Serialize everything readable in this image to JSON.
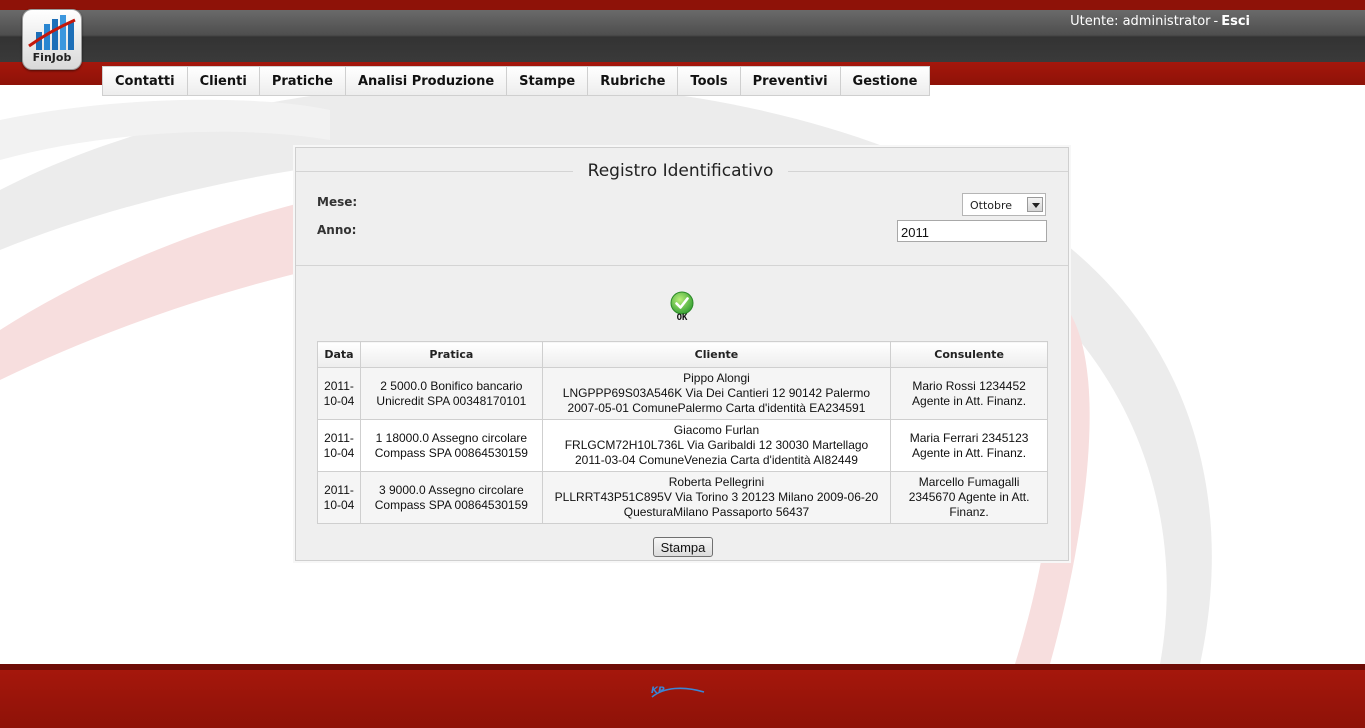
{
  "header": {
    "logo_text": "FinJob",
    "user_label": "Utente: administrator",
    "separator": "-",
    "logout_label": "Esci"
  },
  "nav": {
    "items": [
      "Contatti",
      "Clienti",
      "Pratiche",
      "Analisi Produzione",
      "Stampe",
      "Rubriche",
      "Tools",
      "Preventivi",
      "Gestione"
    ]
  },
  "panel": {
    "title": "Registro Identificativo",
    "month_label": "Mese:",
    "month_value": "Ottobre",
    "year_label": "Anno:",
    "year_value": "2011",
    "ok_label": "OK",
    "print_label": "Stampa"
  },
  "table": {
    "headers": [
      "Data",
      "Pratica",
      "Cliente",
      "Consulente"
    ],
    "rows": [
      {
        "data": [
          "2011-",
          "10-04"
        ],
        "pratica": [
          "2 5000.0 Bonifico bancario",
          "Unicredit SPA 00348170101"
        ],
        "cliente": [
          "Pippo Alongi",
          "LNGPPP69S03A546K Via Dei Cantieri 12 90142 Palermo",
          "2007-05-01 ComunePalermo Carta d'identità EA234591"
        ],
        "consulente": [
          "Mario Rossi 1234452",
          "Agente in Att. Finanz."
        ]
      },
      {
        "data": [
          "2011-",
          "10-04"
        ],
        "pratica": [
          "1 18000.0 Assegno circolare",
          "Compass SPA 00864530159"
        ],
        "cliente": [
          "Giacomo Furlan",
          "FRLGCM72H10L736L Via Garibaldi 12 30030 Martellago",
          "2011-03-04 ComuneVenezia Carta d'identità AI82449"
        ],
        "consulente": [
          "Maria Ferrari 2345123",
          "Agente in Att. Finanz."
        ]
      },
      {
        "data": [
          "2011-",
          "10-04"
        ],
        "pratica": [
          "3 9000.0 Assegno circolare",
          "Compass SPA 00864530159"
        ],
        "cliente": [
          "Roberta Pellegrini",
          "PLLRRT43P51C895V Via Torino 3 20123 Milano 2009-06-20",
          "QuesturaMilano Passaporto 56437"
        ],
        "consulente": [
          "Marcello Fumagalli",
          "2345670 Agente in Att.",
          "Finanz."
        ]
      }
    ]
  },
  "footer": {
    "logo_text": "KP"
  },
  "colors": {
    "brand_red": "#8e1208",
    "dark_band": "#4e4e4e",
    "ok_green": "#3aa336"
  }
}
